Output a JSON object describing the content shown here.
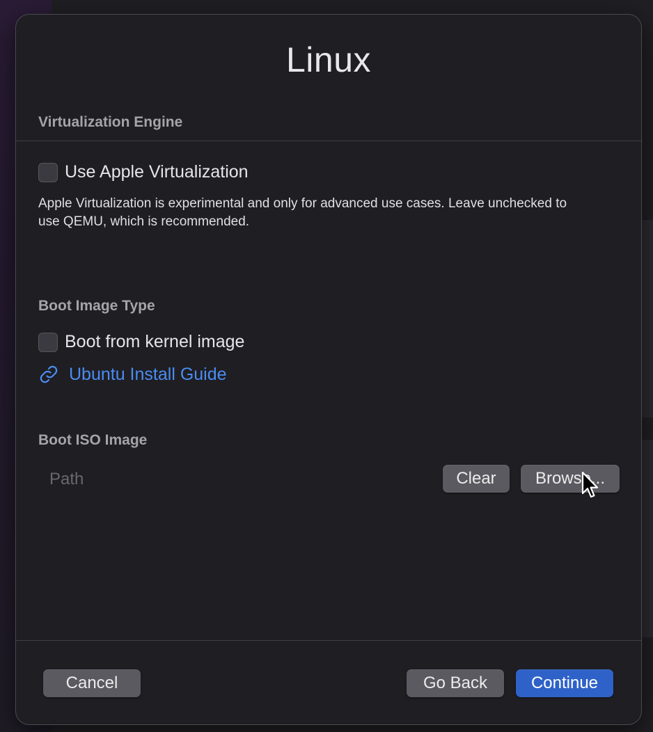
{
  "dialog": {
    "title": "Linux"
  },
  "virtualization": {
    "section_label": "Virtualization Engine",
    "apple_virtualization_label": "Use Apple Virtualization",
    "apple_virtualization_checked": false,
    "description": "Apple Virtualization is experimental and only for advanced use cases. Leave unchecked to use QEMU, which is recommended."
  },
  "boot_image_type": {
    "section_label": "Boot Image Type",
    "kernel_image_label": "Boot from kernel image",
    "kernel_image_checked": false,
    "guide_link": "Ubuntu Install Guide",
    "guide_icon": "link-icon"
  },
  "boot_iso": {
    "section_label": "Boot ISO Image",
    "path_value": "",
    "path_placeholder": "Path",
    "clear_label": "Clear",
    "browse_label": "Browse..."
  },
  "footer": {
    "cancel_label": "Cancel",
    "go_back_label": "Go Back",
    "continue_label": "Continue"
  },
  "colors": {
    "accent": "#2f62c8",
    "link": "#4b8cf0"
  }
}
